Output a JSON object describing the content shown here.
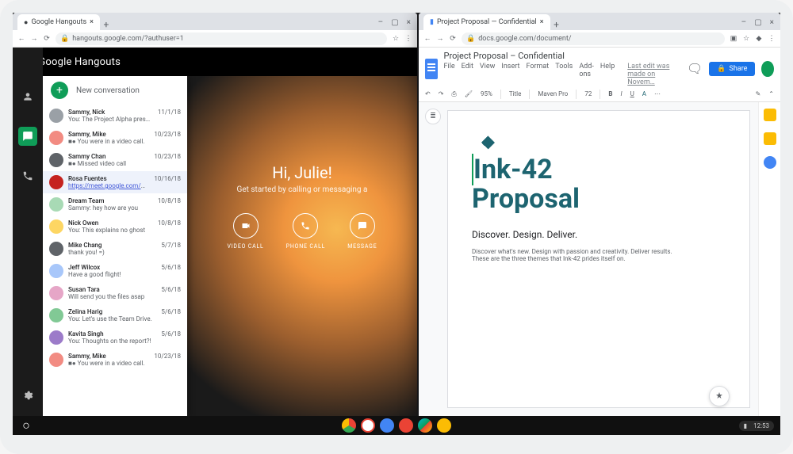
{
  "hangouts_window": {
    "tab_title": "Google Hangouts",
    "url": "hangouts.google.com/?authuser=1",
    "app_title": "Google Hangouts",
    "new_conversation_label": "New conversation",
    "hero_greeting": "Hi, Julie!",
    "hero_sub": "Get started by calling or messaging a",
    "actions": {
      "video": "VIDEO CALL",
      "phone": "PHONE CALL",
      "message": "MESSAGE"
    },
    "conversations": [
      {
        "name": "Sammy, Nick",
        "snippet": "You: The Project Alpha presentation has been r",
        "date": "11/1/18"
      },
      {
        "name": "Sammy, Mike",
        "snippet": "■● You were in a video call.",
        "date": "10/23/18"
      },
      {
        "name": "Sammy Chan",
        "snippet": "■● Missed video call",
        "date": "10/23/18"
      },
      {
        "name": "Rosa Fuentes",
        "snippet": "https://meet.google.com/msd-jpx-ifx",
        "date": "10/16/18",
        "link": true,
        "selected": true
      },
      {
        "name": "Dream Team",
        "snippet": "Sammy: hey how are you",
        "date": "10/8/18"
      },
      {
        "name": "Nick Owen",
        "snippet": "You: This explains no ghost",
        "date": "10/8/18"
      },
      {
        "name": "Mike Chang",
        "snippet": "thank you! =)",
        "date": "5/7/18"
      },
      {
        "name": "Jeff Wilcox",
        "snippet": "Have a good flight!",
        "date": "5/6/18"
      },
      {
        "name": "Susan Tara",
        "snippet": "Will send you the files asap",
        "date": "5/6/18"
      },
      {
        "name": "Zelina Harig",
        "snippet": "You: Let's use the Team Drive.",
        "date": "5/6/18"
      },
      {
        "name": "Kavita Singh",
        "snippet": "You: Thoughts on the report?!",
        "date": "5/6/18"
      },
      {
        "name": "Sammy, Mike",
        "snippet": "■● You were in a video call.",
        "date": "10/23/18"
      }
    ],
    "avatar_colors": [
      "#9aa0a6",
      "#f28b82",
      "#5f6368",
      "#c5221f",
      "#a8dab5",
      "#fdd663",
      "#5f6368",
      "#a8c7fa",
      "#e6a6c7",
      "#81c995",
      "#9c7bc9",
      "#f28b82"
    ]
  },
  "docs_window": {
    "tab_title": "Project Proposal — Confidential",
    "url": "docs.google.com/document/",
    "doc_title": "Project Proposal – Confidential",
    "menus": [
      "File",
      "Edit",
      "View",
      "Insert",
      "Format",
      "Tools",
      "Add-ons",
      "Help"
    ],
    "last_edit": "Last edit was made on Novem…",
    "share_label": "Share",
    "toolbar": {
      "zoom": "95%",
      "style": "Title",
      "font": "Maven Pro",
      "size": "72"
    },
    "content": {
      "h1_line1": "Ink-42",
      "h1_line2": "Proposal",
      "tagline": "Discover. Design. Deliver.",
      "para": "Discover what's new. Design with passion and creativity. Deliver results. These are the three themes that Ink-42 prides itself on."
    }
  },
  "shelf": {
    "time": "12:53"
  }
}
